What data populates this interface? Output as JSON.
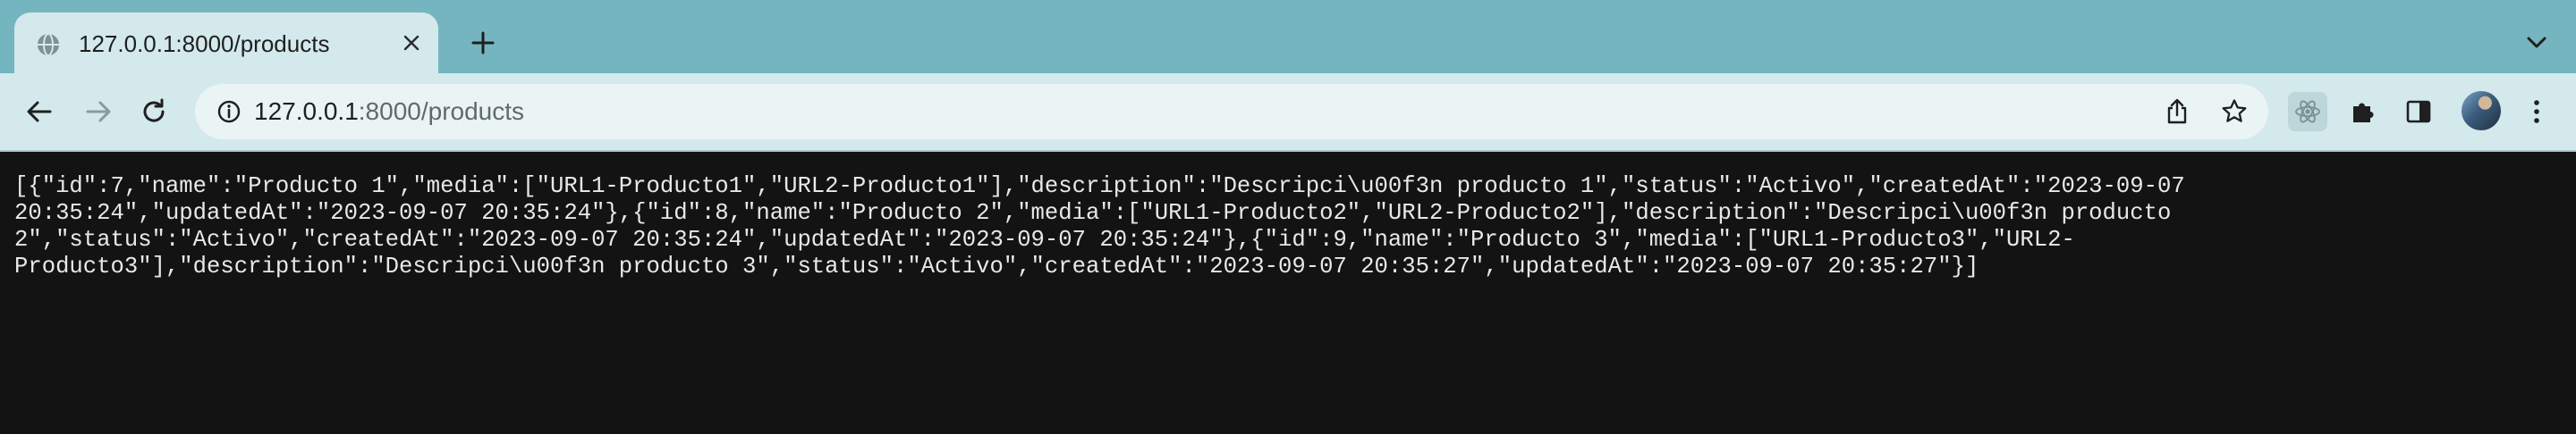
{
  "browser": {
    "tab": {
      "title": "127.0.0.1:8000/products"
    },
    "address_bar": {
      "host": "127.0.0.1",
      "path": ":8000/products"
    }
  },
  "page": {
    "json_lines": [
      "[{\"id\":7,\"name\":\"Producto 1\",\"media\":[\"URL1-Producto1\",\"URL2-Producto1\"],\"description\":\"Descripci\\u00f3n producto 1\",\"status\":\"Activo\",\"createdAt\":\"2023-09-07",
      "20:35:24\",\"updatedAt\":\"2023-09-07 20:35:24\"},{\"id\":8,\"name\":\"Producto 2\",\"media\":[\"URL1-Producto2\",\"URL2-Producto2\"],\"description\":\"Descripci\\u00f3n producto",
      "2\",\"status\":\"Activo\",\"createdAt\":\"2023-09-07 20:35:24\",\"updatedAt\":\"2023-09-07 20:35:24\"},{\"id\":9,\"name\":\"Producto 3\",\"media\":[\"URL1-Producto3\",\"URL2-",
      "Producto3\"],\"description\":\"Descripci\\u00f3n producto 3\",\"status\":\"Activo\",\"createdAt\":\"2023-09-07 20:35:27\",\"updatedAt\":\"2023-09-07 20:35:27\"}]"
    ]
  },
  "colors": {
    "tabstrip": "#74b5bf",
    "toolbar": "#d3e9eb",
    "omnibox": "#eaf4f5",
    "page_bg": "#131313",
    "text": "#e8e8e8"
  }
}
